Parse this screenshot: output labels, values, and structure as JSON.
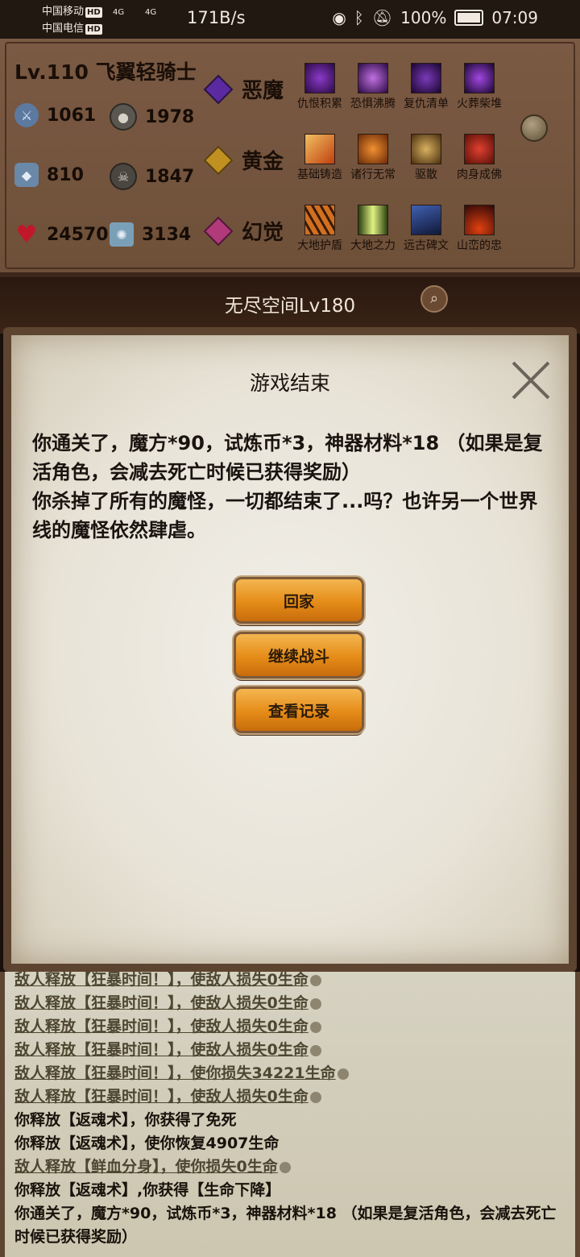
{
  "status_bar": {
    "carrier_1": "中国移动",
    "carrier_2": "中国电信",
    "hd": "HD",
    "network": "4G",
    "speed": "171B/s",
    "battery": "100%",
    "time": "07:09"
  },
  "character": {
    "title": "Lv.110 飞翼轻骑士",
    "stats": {
      "attack": "1061",
      "stat_2": "1978",
      "defense": "810",
      "stat_4": "1847",
      "hp": "24570",
      "stat_6": "3134"
    },
    "runes": [
      {
        "name": "恶魔",
        "color": "#5b2aa0",
        "skills": [
          "仇恨积累",
          "恐惧沸腾",
          "复仇清单",
          "火葬柴堆"
        ]
      },
      {
        "name": "黄金",
        "color": "#c09020",
        "skills": [
          "基础铸造",
          "诸行无常",
          "驱散",
          "肉身成佛"
        ]
      },
      {
        "name": "幻觉",
        "color": "#b03a7a",
        "skills": [
          "大地护盾",
          "大地之力",
          "远古碑文",
          "山峦的忠"
        ]
      }
    ]
  },
  "dungeon": {
    "name": "无尽空间Lv180"
  },
  "dialog": {
    "title": "游戏结束",
    "message_1": "你通关了，魔方*90，试炼币*3，神器材料*18 （如果是复活角色，会减去死亡时候已获得奖励）",
    "message_2": "你杀掉了所有的魔怪，一切都结束了...吗？也许另一个世界线的魔怪依然肆虐。",
    "buttons": {
      "home": "回家",
      "continue": "继续战斗",
      "records": "查看记录"
    }
  },
  "battle_log": [
    {
      "type": "enemy",
      "text": "敌人释放【狂暴时间！】，使敌人损失0生命",
      "coin": true
    },
    {
      "type": "enemy",
      "text": "敌人释放【狂暴时间！】，使敌人损失0生命",
      "coin": true
    },
    {
      "type": "enemy",
      "text": "敌人释放【狂暴时间！】，使敌人损失0生命",
      "coin": true
    },
    {
      "type": "enemy",
      "text": "敌人释放【狂暴时间！】，使敌人损失0生命",
      "coin": true
    },
    {
      "type": "enemy",
      "text": "敌人释放【狂暴时间！】，使你损失34221生命",
      "coin": true
    },
    {
      "type": "enemy",
      "text": "敌人释放【狂暴时间！】，使敌人损失0生命",
      "coin": true
    },
    {
      "type": "player",
      "text": "你释放【返魂术】，你获得了免死",
      "coin": false
    },
    {
      "type": "player",
      "text": "你释放【返魂术】，使你恢复4907生命",
      "coin": false
    },
    {
      "type": "enemy",
      "text": "敌人释放【鲜血分身】，使你损失0生命",
      "coin": true
    },
    {
      "type": "player",
      "text": "你释放【返魂术】,你获得【生命下降】",
      "coin": false
    }
  ],
  "battle_log_final": "你通关了，魔方*90，试炼币*3，神器材料*18 （如果是复活角色，会减去死亡时候已获得奖励）"
}
